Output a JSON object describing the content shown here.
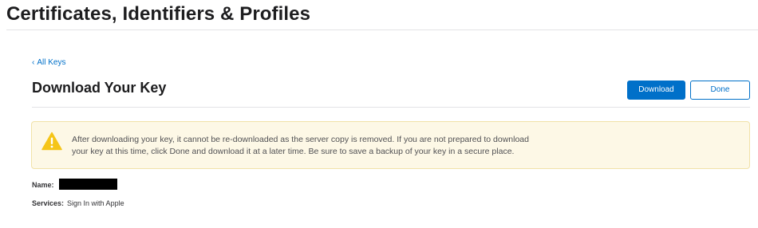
{
  "header": {
    "title": "Certificates, Identifiers & Profiles"
  },
  "nav": {
    "back_label": "All Keys",
    "back_chevron": "‹"
  },
  "section": {
    "title": "Download Your Key",
    "download_label": "Download",
    "done_label": "Done"
  },
  "alert": {
    "icon": "warning-icon",
    "icon_color": "#f5c518",
    "line1": "After downloading your key, it cannot be re-downloaded as the server copy is removed. If you are not prepared to download",
    "line2": "your key at this time, click Done and download it at a later time. Be sure to save a backup of your key in a secure place."
  },
  "details": {
    "name_label": "Name:",
    "services_label": "Services:",
    "services_value": "Sign In with Apple"
  },
  "colors": {
    "accent": "#0070c9",
    "alert_background": "#fdf8e6",
    "alert_border": "#f1e2a8"
  }
}
